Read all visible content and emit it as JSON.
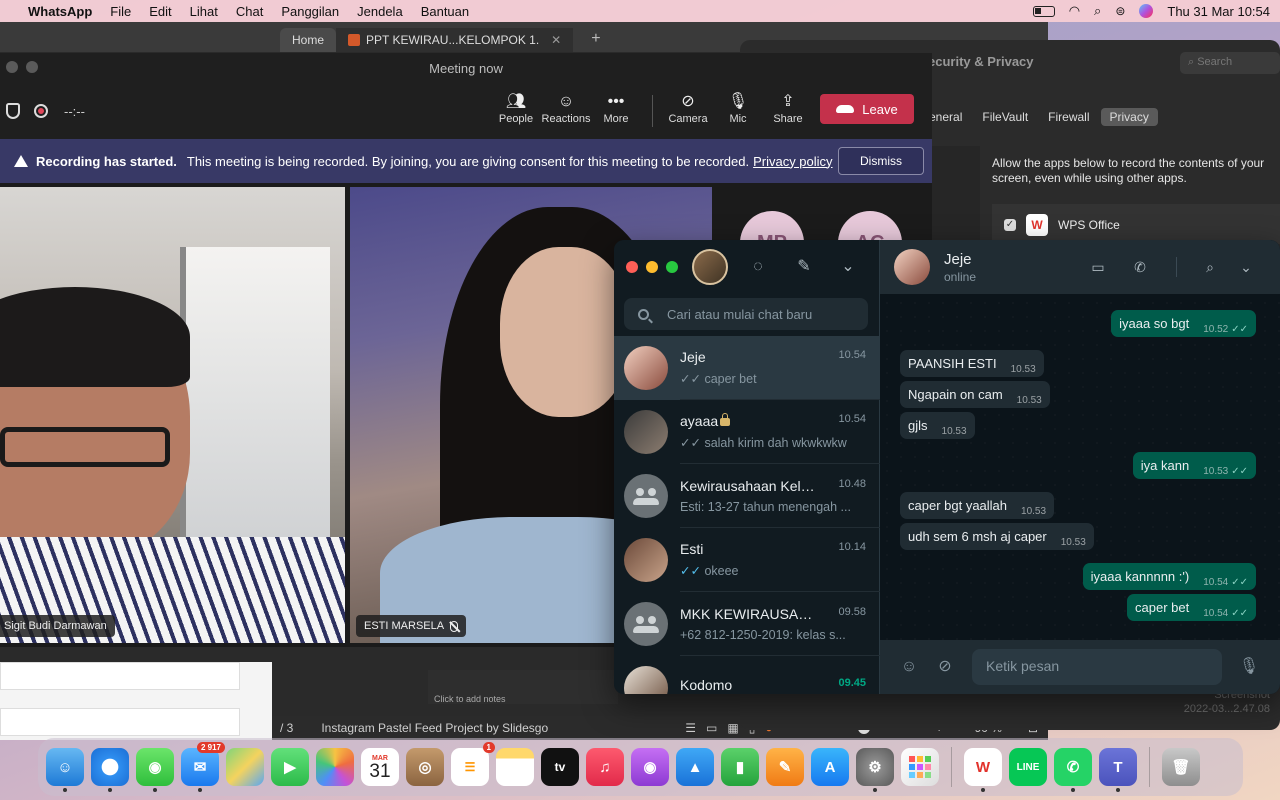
{
  "menubar": {
    "app_name": "WhatsApp",
    "items": [
      "File",
      "Edit",
      "Lihat",
      "Chat",
      "Panggilan",
      "Jendela",
      "Bantuan"
    ],
    "datetime": "Thu 31 Mar  10:54"
  },
  "ppt": {
    "tab_home": "Home",
    "tab_doc": "PPT KEWIRAU...KELOMPOK 1.",
    "notes_placeholder": "Click to add notes",
    "slide_counter": "/ 3",
    "theme_name": "Instagram Pastel Feed Project by Slidesgo",
    "zoom": "90 %"
  },
  "sysprefs": {
    "title": "ecurity & Privacy",
    "search_placeholder": "Search",
    "tabs": [
      "eneral",
      "FileVault",
      "Firewall",
      "Privacy"
    ],
    "active_tab": "Privacy",
    "description": "Allow the apps below to record the contents of your screen, even while using other apps.",
    "app_name": "WPS Office",
    "screenshot_label_1": "Screenshot",
    "screenshot_label_2": "2022-03...2.47.08"
  },
  "teams": {
    "title": "Meeting now",
    "timer": "--:--",
    "toolbar": {
      "people": "People",
      "reactions": "Reactions",
      "more": "More",
      "camera": "Camera",
      "mic": "Mic",
      "share": "Share",
      "leave": "Leave"
    },
    "banner": {
      "title": "Recording has started.",
      "text": "This meeting is being recorded. By joining, you are giving consent for this meeting to be recorded.",
      "policy_link": "Privacy policy",
      "dismiss": "Dismiss"
    },
    "participants": [
      {
        "name": "Sigit Budi Darmawan"
      },
      {
        "name": "ESTI MARSELA"
      }
    ],
    "avatars": [
      "MP",
      "AC"
    ]
  },
  "whatsapp": {
    "search_placeholder": "Cari atau mulai chat baru",
    "chats": [
      {
        "name": "Jeje",
        "time": "10.54",
        "preview": "caper bet",
        "ticks": "✓✓"
      },
      {
        "name": "ayaaa",
        "time": "10.54",
        "preview": "salah kirim dah wkwkwkw",
        "ticks": "✓✓"
      },
      {
        "name": "Kewirausahaan Kelo...",
        "time": "10.48",
        "preview": "Esti: 13-27 tahun menengah ...",
        "ticks": ""
      },
      {
        "name": "Esti",
        "time": "10.14",
        "preview": "okeee",
        "ticks": "✓✓"
      },
      {
        "name": "MKK KEWIRAUSAH...",
        "time": "09.58",
        "preview": "+62 812-1250-2019: kelas s...",
        "ticks": ""
      },
      {
        "name": "Kodomo",
        "time": "09.45",
        "preview": "",
        "ticks": ""
      }
    ],
    "contact": {
      "name": "Jeje",
      "status": "online"
    },
    "messages": [
      {
        "dir": "out",
        "text": "iyaaa so bgt",
        "time": "10.52"
      },
      {
        "dir": "in",
        "text": "PAANSIH ESTI",
        "time": "10.53"
      },
      {
        "dir": "in",
        "text": "Ngapain on cam",
        "time": "10.53"
      },
      {
        "dir": "in",
        "text": "gjls",
        "time": "10.53"
      },
      {
        "dir": "out",
        "text": "iya kann",
        "time": "10.53"
      },
      {
        "dir": "in",
        "text": "caper bgt yaallah",
        "time": "10.53"
      },
      {
        "dir": "in",
        "text": "udh sem 6 msh aj caper",
        "time": "10.53"
      },
      {
        "dir": "out",
        "text": "iyaaa kannnnn :')",
        "time": "10.54"
      },
      {
        "dir": "out",
        "text": "caper bet",
        "time": "10.54"
      }
    ],
    "compose_placeholder": "Ketik pesan"
  },
  "dock": {
    "mail_badge": "2 917",
    "reminders_badge": "1",
    "calendar_month": "MAR",
    "calendar_day": "31",
    "appletv_label": "tv"
  },
  "colors": {
    "leave_red": "#c4314b",
    "banner_purple": "#383966",
    "wa_green_bubble": "#005c4b",
    "wa_bg": "#111b21"
  }
}
